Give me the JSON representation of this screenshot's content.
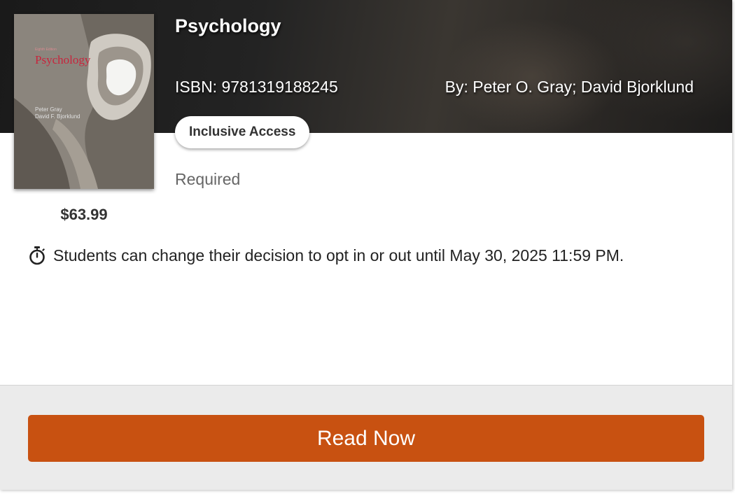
{
  "book": {
    "title": "Psychology",
    "isbn": "ISBN: 9781319188245",
    "authors": "By: Peter O. Gray; David Bjorklund",
    "price": "$63.99",
    "badge": "Inclusive Access",
    "status": "Required",
    "cover": {
      "edition": "Eighth Edition",
      "title": "Psychology",
      "author_1": "Peter Gray",
      "author_2": "David F. Bjorklund"
    }
  },
  "notice": {
    "icon": "stopwatch-icon",
    "text": "Students can change their decision to opt in or out until May 30, 2025 11:59 PM."
  },
  "actions": {
    "read_now": "Read Now"
  },
  "colors": {
    "accent": "#c85111",
    "footer_bg": "#ebebeb",
    "hero_bg": "#1f1f1f"
  }
}
